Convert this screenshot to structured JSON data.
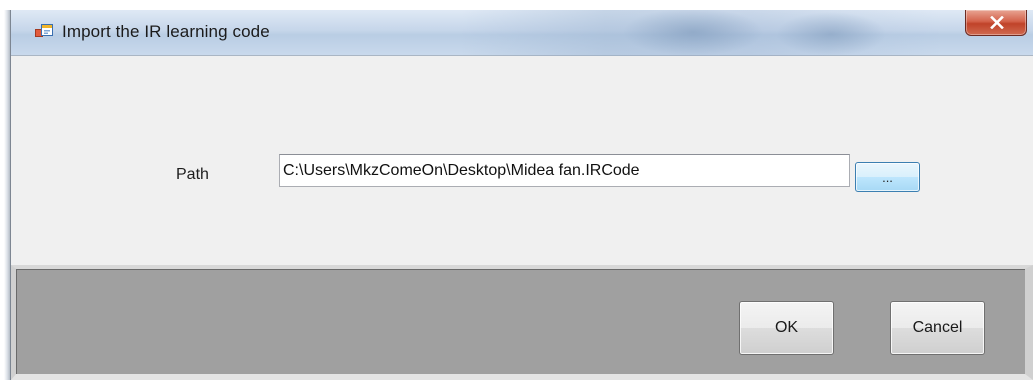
{
  "window": {
    "title": "Import the IR learning code",
    "close_glyph": "X",
    "icon": "form-window-icon"
  },
  "form": {
    "path_label": "Path",
    "path_value": "C:\\Users\\MkzComeOn\\Desktop\\Midea fan.IRCode",
    "browse_label": "..."
  },
  "footer": {
    "ok_label": "OK",
    "cancel_label": "Cancel"
  },
  "colors": {
    "title_bar": "#c6d6ea",
    "close_button": "#c0432a",
    "dialog_background": "#f0f0f0",
    "footer_background": "#a0a0a0",
    "browse_button_border": "#3c7fb1"
  }
}
